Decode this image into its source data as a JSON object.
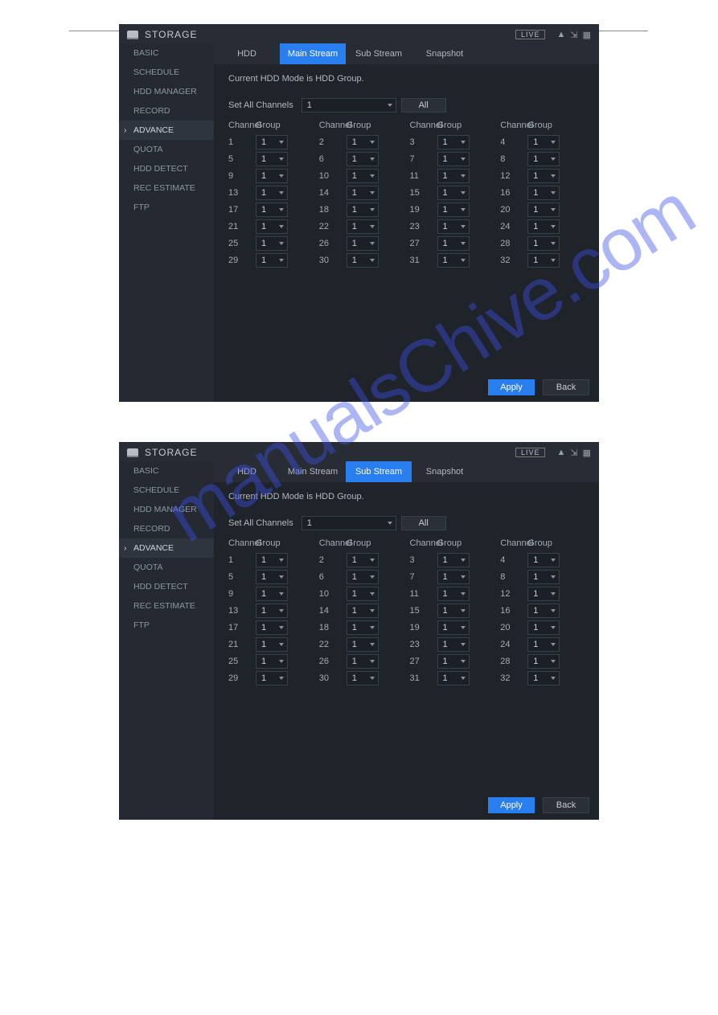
{
  "watermark": "manualsChive.com",
  "titlebar": {
    "title": "STORAGE",
    "live": "LIVE"
  },
  "sidebar": {
    "items": [
      {
        "label": "BASIC"
      },
      {
        "label": "SCHEDULE"
      },
      {
        "label": "HDD MANAGER"
      },
      {
        "label": "RECORD"
      },
      {
        "label": "ADVANCE"
      },
      {
        "label": "QUOTA"
      },
      {
        "label": "HDD DETECT"
      },
      {
        "label": "REC ESTIMATE"
      },
      {
        "label": "FTP"
      }
    ],
    "active_index": 4
  },
  "tabs": [
    {
      "label": "HDD"
    },
    {
      "label": "Main Stream"
    },
    {
      "label": "Sub Stream"
    },
    {
      "label": "Snapshot"
    }
  ],
  "content": {
    "mode_text": "Current HDD Mode is HDD Group.",
    "set_all_label": "Set All Channels",
    "set_all_value": "1",
    "all_btn": "All",
    "head_channel": "Channel",
    "head_group": "Group",
    "channels": [
      {
        "ch": "1",
        "g": "1"
      },
      {
        "ch": "2",
        "g": "1"
      },
      {
        "ch": "3",
        "g": "1"
      },
      {
        "ch": "4",
        "g": "1"
      },
      {
        "ch": "5",
        "g": "1"
      },
      {
        "ch": "6",
        "g": "1"
      },
      {
        "ch": "7",
        "g": "1"
      },
      {
        "ch": "8",
        "g": "1"
      },
      {
        "ch": "9",
        "g": "1"
      },
      {
        "ch": "10",
        "g": "1"
      },
      {
        "ch": "11",
        "g": "1"
      },
      {
        "ch": "12",
        "g": "1"
      },
      {
        "ch": "13",
        "g": "1"
      },
      {
        "ch": "14",
        "g": "1"
      },
      {
        "ch": "15",
        "g": "1"
      },
      {
        "ch": "16",
        "g": "1"
      },
      {
        "ch": "17",
        "g": "1"
      },
      {
        "ch": "18",
        "g": "1"
      },
      {
        "ch": "19",
        "g": "1"
      },
      {
        "ch": "20",
        "g": "1"
      },
      {
        "ch": "21",
        "g": "1"
      },
      {
        "ch": "22",
        "g": "1"
      },
      {
        "ch": "23",
        "g": "1"
      },
      {
        "ch": "24",
        "g": "1"
      },
      {
        "ch": "25",
        "g": "1"
      },
      {
        "ch": "26",
        "g": "1"
      },
      {
        "ch": "27",
        "g": "1"
      },
      {
        "ch": "28",
        "g": "1"
      },
      {
        "ch": "29",
        "g": "1"
      },
      {
        "ch": "30",
        "g": "1"
      },
      {
        "ch": "31",
        "g": "1"
      },
      {
        "ch": "32",
        "g": "1"
      }
    ]
  },
  "footer": {
    "apply": "Apply",
    "back": "Back"
  },
  "panels": [
    {
      "active_tab": 1
    },
    {
      "active_tab": 2
    }
  ]
}
